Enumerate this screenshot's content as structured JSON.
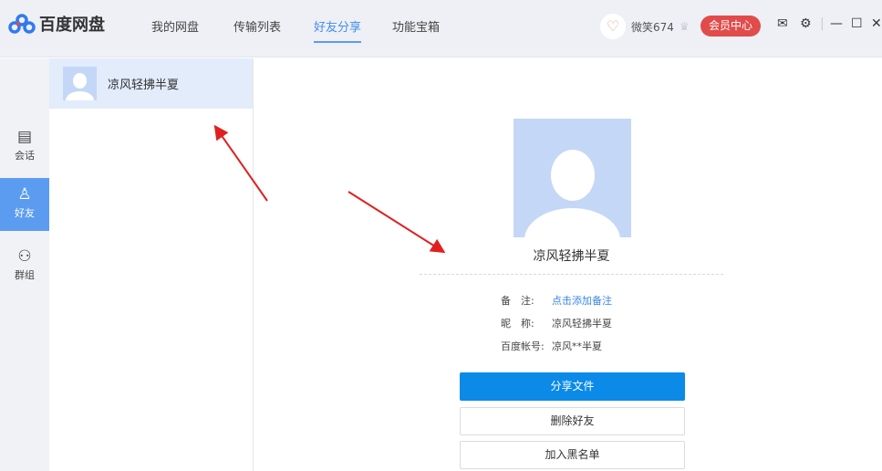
{
  "app": {
    "title": "百度网盘"
  },
  "nav": [
    "我的网盘",
    "传输列表",
    "好友分享",
    "功能宝箱"
  ],
  "nav_active": "好友分享",
  "user": {
    "name": "微笑674",
    "vip_label": "会员中心"
  },
  "rail": [
    {
      "label": "会话",
      "icon": "chat-icon"
    },
    {
      "label": "好友",
      "icon": "user-icon"
    },
    {
      "label": "群组",
      "icon": "group-icon"
    }
  ],
  "friends": [
    {
      "name": "凉风轻拂半夏"
    }
  ],
  "profile": {
    "name": "凉风轻拂半夏",
    "fields": [
      {
        "key": "备　注:",
        "value": "点击添加备注"
      },
      {
        "key": "昵　称:",
        "value": "凉风轻拂半夏"
      },
      {
        "key": "百度帐号:",
        "value": "凉风**半夏"
      }
    ],
    "buttons": {
      "share": "分享文件",
      "delete": "删除好友",
      "blacklist": "加入黑名单"
    }
  },
  "colors": {
    "accent": "#0b8ae8",
    "vip": "#e24b4b",
    "arrow": "#e02020"
  }
}
